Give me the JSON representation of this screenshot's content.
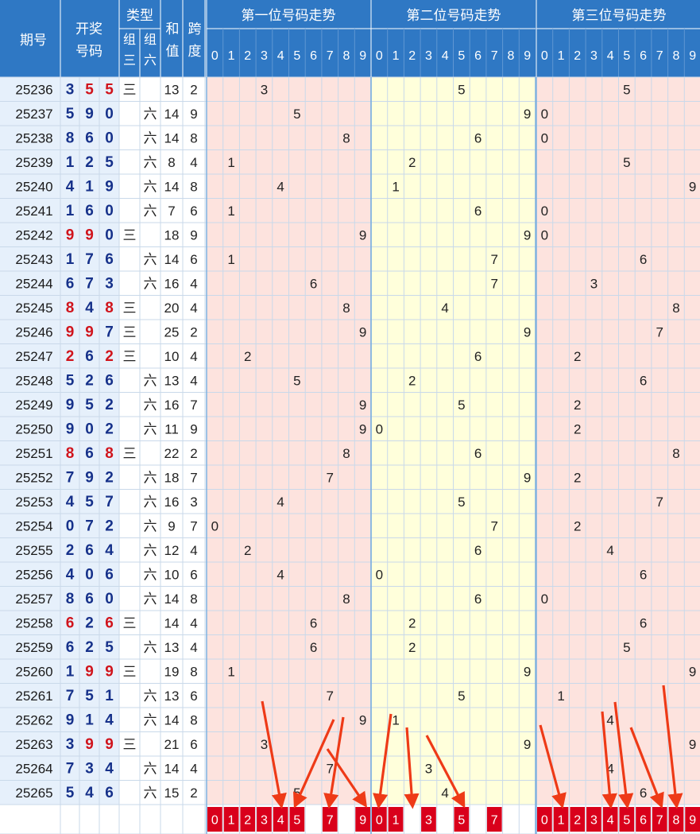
{
  "headers": {
    "period": "期号",
    "draw": [
      "开奖",
      "号码"
    ],
    "type": "类型",
    "type_zu3": [
      "组",
      "三"
    ],
    "type_zu6": [
      "组",
      "六"
    ],
    "sum": [
      "和",
      "值"
    ],
    "span": [
      "跨",
      "度"
    ],
    "pos1": "第一位号码走势",
    "pos2": "第二位号码走势",
    "pos3": "第三位号码走势",
    "digits": [
      "0",
      "1",
      "2",
      "3",
      "4",
      "5",
      "6",
      "7",
      "8",
      "9"
    ]
  },
  "type_labels": {
    "z3": "三",
    "z6": "六"
  },
  "colors": {
    "header_bg": "#2f78c4",
    "period_bg": "#e6f0fb",
    "draw_digit_blue": "#16318a",
    "draw_digit_red": "#d0141c",
    "pos1_bg": "#fde3de",
    "pos2_bg": "#ffffdb",
    "pos3_bg": "#fde3de",
    "grid_line": "#c9d9ea",
    "selected_box": "#d9001b",
    "arrow": "#ee3a17"
  },
  "chart_data": {
    "type": "table",
    "rows": [
      {
        "period": "25236",
        "draw": [
          3,
          5,
          5
        ],
        "type": "z3",
        "sum": 13,
        "span": 2
      },
      {
        "period": "25237",
        "draw": [
          5,
          9,
          0
        ],
        "type": "z6",
        "sum": 14,
        "span": 9
      },
      {
        "period": "25238",
        "draw": [
          8,
          6,
          0
        ],
        "type": "z6",
        "sum": 14,
        "span": 8
      },
      {
        "period": "25239",
        "draw": [
          1,
          2,
          5
        ],
        "type": "z6",
        "sum": 8,
        "span": 4
      },
      {
        "period": "25240",
        "draw": [
          4,
          1,
          9
        ],
        "type": "z6",
        "sum": 14,
        "span": 8
      },
      {
        "period": "25241",
        "draw": [
          1,
          6,
          0
        ],
        "type": "z6",
        "sum": 7,
        "span": 6
      },
      {
        "period": "25242",
        "draw": [
          9,
          9,
          0
        ],
        "type": "z3",
        "sum": 18,
        "span": 9
      },
      {
        "period": "25243",
        "draw": [
          1,
          7,
          6
        ],
        "type": "z6",
        "sum": 14,
        "span": 6
      },
      {
        "period": "25244",
        "draw": [
          6,
          7,
          3
        ],
        "type": "z6",
        "sum": 16,
        "span": 4
      },
      {
        "period": "25245",
        "draw": [
          8,
          4,
          8
        ],
        "type": "z3",
        "sum": 20,
        "span": 4
      },
      {
        "period": "25246",
        "draw": [
          9,
          9,
          7
        ],
        "type": "z3",
        "sum": 25,
        "span": 2
      },
      {
        "period": "25247",
        "draw": [
          2,
          6,
          2
        ],
        "type": "z3",
        "sum": 10,
        "span": 4
      },
      {
        "period": "25248",
        "draw": [
          5,
          2,
          6
        ],
        "type": "z6",
        "sum": 13,
        "span": 4
      },
      {
        "period": "25249",
        "draw": [
          9,
          5,
          2
        ],
        "type": "z6",
        "sum": 16,
        "span": 7
      },
      {
        "period": "25250",
        "draw": [
          9,
          0,
          2
        ],
        "type": "z6",
        "sum": 11,
        "span": 9
      },
      {
        "period": "25251",
        "draw": [
          8,
          6,
          8
        ],
        "type": "z3",
        "sum": 22,
        "span": 2
      },
      {
        "period": "25252",
        "draw": [
          7,
          9,
          2
        ],
        "type": "z6",
        "sum": 18,
        "span": 7
      },
      {
        "period": "25253",
        "draw": [
          4,
          5,
          7
        ],
        "type": "z6",
        "sum": 16,
        "span": 3
      },
      {
        "period": "25254",
        "draw": [
          0,
          7,
          2
        ],
        "type": "z6",
        "sum": 9,
        "span": 7
      },
      {
        "period": "25255",
        "draw": [
          2,
          6,
          4
        ],
        "type": "z6",
        "sum": 12,
        "span": 4
      },
      {
        "period": "25256",
        "draw": [
          4,
          0,
          6
        ],
        "type": "z6",
        "sum": 10,
        "span": 6
      },
      {
        "period": "25257",
        "draw": [
          8,
          6,
          0
        ],
        "type": "z6",
        "sum": 14,
        "span": 8
      },
      {
        "period": "25258",
        "draw": [
          6,
          2,
          6
        ],
        "type": "z3",
        "sum": 14,
        "span": 4
      },
      {
        "period": "25259",
        "draw": [
          6,
          2,
          5
        ],
        "type": "z6",
        "sum": 13,
        "span": 4
      },
      {
        "period": "25260",
        "draw": [
          1,
          9,
          9
        ],
        "type": "z3",
        "sum": 19,
        "span": 8
      },
      {
        "period": "25261",
        "draw": [
          7,
          5,
          1
        ],
        "type": "z6",
        "sum": 13,
        "span": 6
      },
      {
        "period": "25262",
        "draw": [
          9,
          1,
          4
        ],
        "type": "z6",
        "sum": 14,
        "span": 8
      },
      {
        "period": "25263",
        "draw": [
          3,
          9,
          9
        ],
        "type": "z3",
        "sum": 21,
        "span": 6
      },
      {
        "period": "25264",
        "draw": [
          7,
          3,
          4
        ],
        "type": "z6",
        "sum": 14,
        "span": 4
      },
      {
        "period": "25265",
        "draw": [
          5,
          4,
          6
        ],
        "type": "z6",
        "sum": 15,
        "span": 2
      }
    ],
    "selected_digits": {
      "pos1": [
        0,
        1,
        2,
        3,
        4,
        5,
        7,
        9
      ],
      "pos2": [
        0,
        1,
        3,
        5,
        7
      ],
      "pos3": [
        0,
        1,
        2,
        3,
        4,
        5,
        6,
        7,
        8,
        9
      ]
    }
  }
}
